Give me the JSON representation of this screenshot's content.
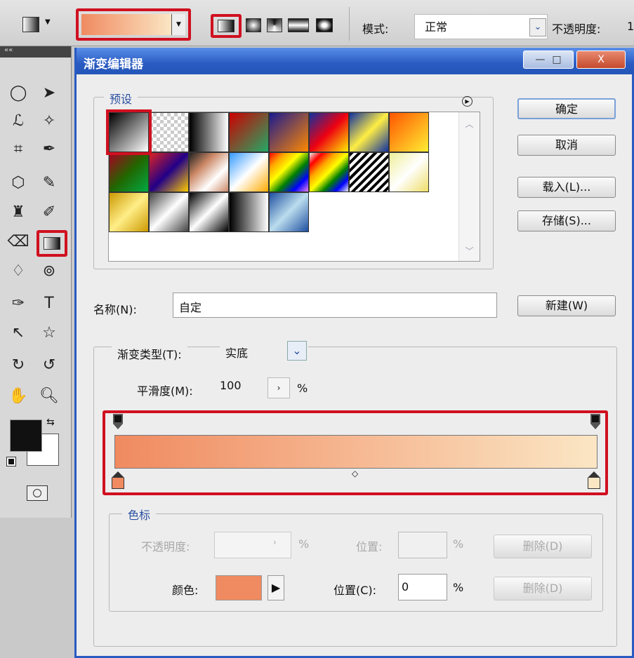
{
  "options_bar": {
    "mode_label": "模式:",
    "mode_value": "正常",
    "opacity_label": "不透明度:",
    "opacity_value": "1",
    "gradient_colors": [
      "#f08a60",
      "#fbe6c4"
    ],
    "gradient_types": [
      "linear",
      "radial",
      "angle",
      "reflected",
      "diamond"
    ]
  },
  "toolbox": {
    "collapse": "««"
  },
  "dialog": {
    "title": "渐变编辑器",
    "window_buttons": {
      "minimize": "—",
      "maximize": "□",
      "close": "X"
    },
    "presets_label": "预设",
    "buttons": {
      "ok": "确定",
      "cancel": "取消",
      "load": "载入(L)...",
      "save": "存储(S)...",
      "new": "新建(W)"
    },
    "name_label": "名称(N):",
    "name_value": "自定",
    "gradient_type_label": "渐变类型(T):",
    "gradient_type_value": "实底",
    "smoothness_label": "平滑度(M):",
    "smoothness_value": "100",
    "percent": "%",
    "gradient": {
      "start_color": "#f08a60",
      "end_color": "#fbe6c4",
      "midpoint_percent": 50
    },
    "stops": {
      "label": "色标",
      "opacity_label": "不透明度:",
      "opacity_value": "",
      "position_label": "位置:",
      "position_value": "",
      "delete1": "删除(D)",
      "color_label": "颜色:",
      "color_value": "#f08a60",
      "position2_label": "位置(C):",
      "position2_value": "0",
      "delete2": "删除(D)"
    }
  }
}
